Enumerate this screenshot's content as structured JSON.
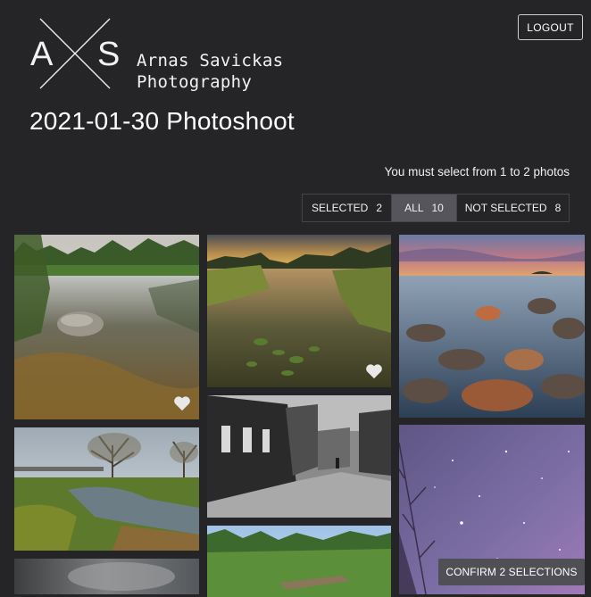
{
  "header": {
    "logo": {
      "letter_left": "A",
      "letter_right": "S",
      "name_line1": "Arnas Savickas",
      "name_line2": "Photography"
    },
    "logout_label": "LOGOUT"
  },
  "page_title": "2021-01-30 Photoshoot",
  "selection_info": "You must select from 1 to 2 photos",
  "filter_tabs": [
    {
      "label": "SELECTED",
      "count": "2",
      "active": false
    },
    {
      "label": "ALL",
      "count": "10",
      "active": true
    },
    {
      "label": "NOT SELECTED",
      "count": "8",
      "active": false
    }
  ],
  "photos": [
    {
      "subject": "misty river with boulder and reeds",
      "selected": true
    },
    {
      "subject": "lake at sunset with reeds and lily pads",
      "selected": true
    },
    {
      "subject": "rocky coast at dusk",
      "selected": false
    },
    {
      "subject": "bare trees by a stream",
      "selected": false
    },
    {
      "subject": "black and white old town street",
      "selected": false
    },
    {
      "subject": "starry night sky over trees",
      "selected": false
    },
    {
      "subject": "cloudy sky",
      "selected": false
    },
    {
      "subject": "forest with boardwalk",
      "selected": false
    }
  ],
  "confirm_label": "CONFIRM 2 SELECTIONS",
  "colors": {
    "background": "#252427",
    "active_tab": "#56555b",
    "confirm_button": "#504f55",
    "text": "#ffffff"
  }
}
